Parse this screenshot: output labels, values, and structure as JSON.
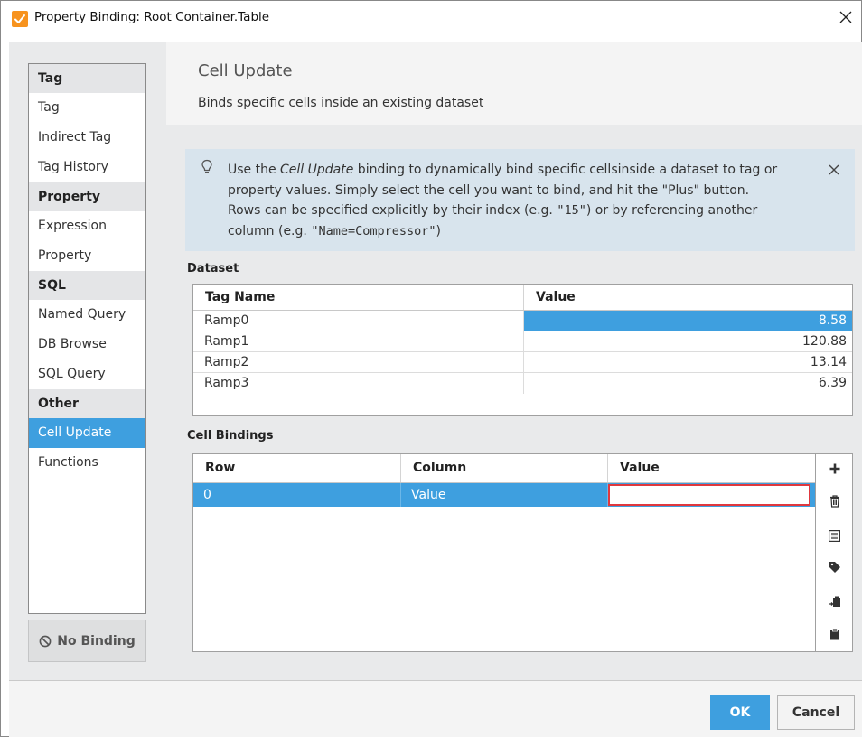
{
  "window": {
    "title": "Property Binding: Root Container.Table",
    "app_icon": "ignition-check-icon",
    "accent": "#3e9fdf"
  },
  "sidebar": {
    "groups": [
      {
        "header": "Tag",
        "items": [
          "Tag",
          "Indirect Tag",
          "Tag History"
        ]
      },
      {
        "header": "Property",
        "items": [
          "Expression",
          "Property"
        ]
      },
      {
        "header": "SQL",
        "items": [
          "Named Query",
          "DB Browse",
          "SQL Query"
        ]
      },
      {
        "header": "Other",
        "items": [
          "Cell Update",
          "Functions"
        ]
      }
    ],
    "selected": "Cell Update",
    "no_binding_label": "No Binding"
  },
  "header": {
    "title": "Cell Update",
    "subtitle": "Binds specific cells inside an existing dataset"
  },
  "info": {
    "line1_pre": "Use the ",
    "line1_em": "Cell Update",
    "line1_post": " binding to dynamically bind specific cellsinside a dataset to tag or",
    "line2": "property values. Simply select the cell you want to bind, and hit the \"Plus\" button.",
    "line3_pre": "Rows can be specified explicitly by their index (e.g. ",
    "line3_code": "\"15\"",
    "line3_post": ") or by referencing another",
    "line4_pre": "column (e.g. ",
    "line4_code": "\"Name=Compressor\"",
    "line4_post": ")"
  },
  "dataset": {
    "label": "Dataset",
    "columns": [
      "Tag Name",
      "Value"
    ],
    "rows": [
      {
        "name": "Ramp0",
        "value": "8.58"
      },
      {
        "name": "Ramp1",
        "value": "120.88"
      },
      {
        "name": "Ramp2",
        "value": "13.14"
      },
      {
        "name": "Ramp3",
        "value": "6.39"
      }
    ],
    "selected_row": 0
  },
  "cell_bindings": {
    "label": "Cell Bindings",
    "columns": [
      "Row",
      "Column",
      "Value"
    ],
    "rows": [
      {
        "row": "0",
        "column": "Value",
        "value": ""
      }
    ],
    "tools": [
      "plus-icon",
      "trash-icon",
      "list-icon",
      "tag-icon",
      "paste-special-icon",
      "clipboard-icon"
    ]
  },
  "buttons": {
    "ok": "OK",
    "cancel": "Cancel"
  }
}
